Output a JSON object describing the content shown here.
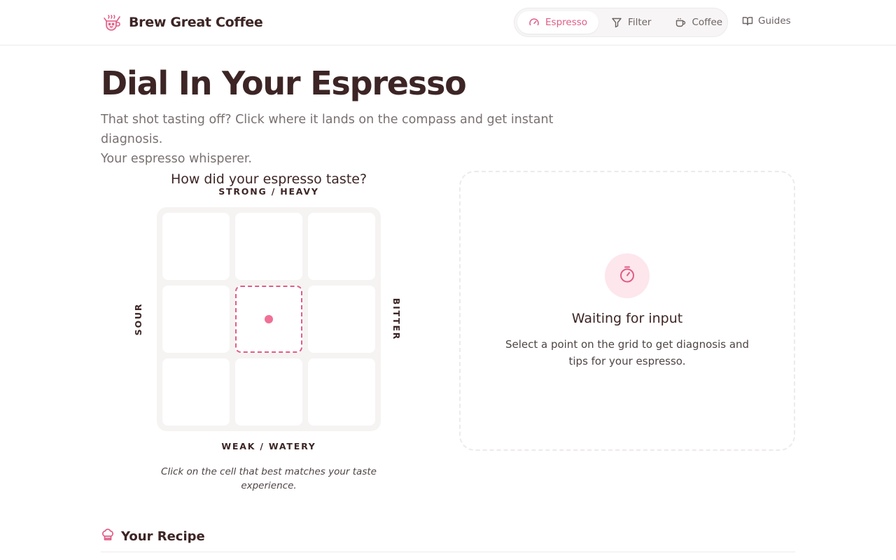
{
  "brand": {
    "name": "Brew Great Coffee",
    "logo_icon": "coffee-mascot-icon"
  },
  "nav": {
    "items": [
      {
        "label": "Espresso",
        "icon": "gauge-icon",
        "active": true
      },
      {
        "label": "Filter",
        "icon": "funnel-icon",
        "active": false
      },
      {
        "label": "Coffee",
        "icon": "cup-icon",
        "active": false
      }
    ],
    "guides_label": "Guides"
  },
  "hero": {
    "title": "Dial In Your Espresso",
    "subtitle_line1": "That shot tasting off? Click where it lands on the compass and get instant diagnosis.",
    "subtitle_line2": "Your espresso whisperer."
  },
  "compass": {
    "heading": "How did your espresso taste?",
    "axis_top": "STRONG / HEAVY",
    "axis_bottom": "WEAK / WATERY",
    "axis_left": "SOUR",
    "axis_right": "BITTER",
    "selected_cell": "middle-center",
    "hint": "Click on the cell that best matches your taste experience."
  },
  "result": {
    "icon": "timer-icon",
    "title": "Waiting for input",
    "text": "Select a point on the grid to get diagnosis and tips for your espresso."
  },
  "recipe": {
    "title": "Your Recipe",
    "icon": "chef-hat-icon"
  },
  "colors": {
    "accent": "#e05d86",
    "accent_light": "#fde6ec",
    "text_dark": "#3d2525",
    "text_muted": "#7a7070",
    "border": "#efeaea"
  }
}
